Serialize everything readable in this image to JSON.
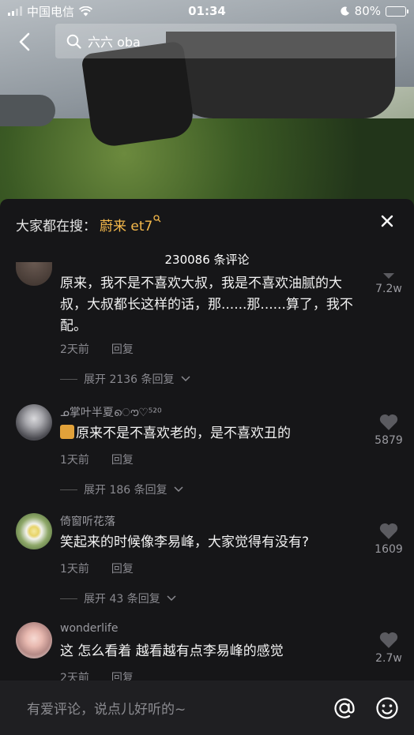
{
  "status_bar": {
    "carrier": "中国电信",
    "time": "01:34",
    "battery": "80%",
    "battery_level": 0.8
  },
  "search": {
    "query": "六六 oba"
  },
  "sheet": {
    "hot_search_label": "大家都在搜：",
    "hot_search_keyword": "蔚来 et7",
    "comment_count": "230086 条评论"
  },
  "comments": [
    {
      "text": "原来，我不是不喜欢大叔，我是不喜欢油腻的大叔，大叔都长这样的话，那......那......算了，我不配。",
      "time": "2天前",
      "reply": "回复",
      "expand": "展开 2136 条回复",
      "likes": "7.2w"
    },
    {
      "user": "ᓄ掌叶半夏ൌ♡⁵²⁰",
      "text": "原来不是不喜欢老的，是不喜欢丑的",
      "time": "1天前",
      "reply": "回复",
      "expand": "展开 186 条回复",
      "likes": "5879"
    },
    {
      "user": "倚窗听花落",
      "text": "笑起来的时候像李易峰，大家觉得有没有?",
      "time": "1天前",
      "reply": "回复",
      "expand": "展开 43 条回复",
      "likes": "1609"
    },
    {
      "user": "wonderlife",
      "text": "这 怎么看着 越看越有点李易峰的感觉",
      "time": "2天前",
      "reply": "回复",
      "likes": "2.7w"
    }
  ],
  "input_bar": {
    "placeholder": "有爱评论，说点儿好听的~"
  },
  "icons": {
    "back": "back-arrow-icon",
    "search": "search-icon",
    "close": "close-icon",
    "like": "heart-icon",
    "mention": "at-icon",
    "emoji": "emoji-icon"
  }
}
